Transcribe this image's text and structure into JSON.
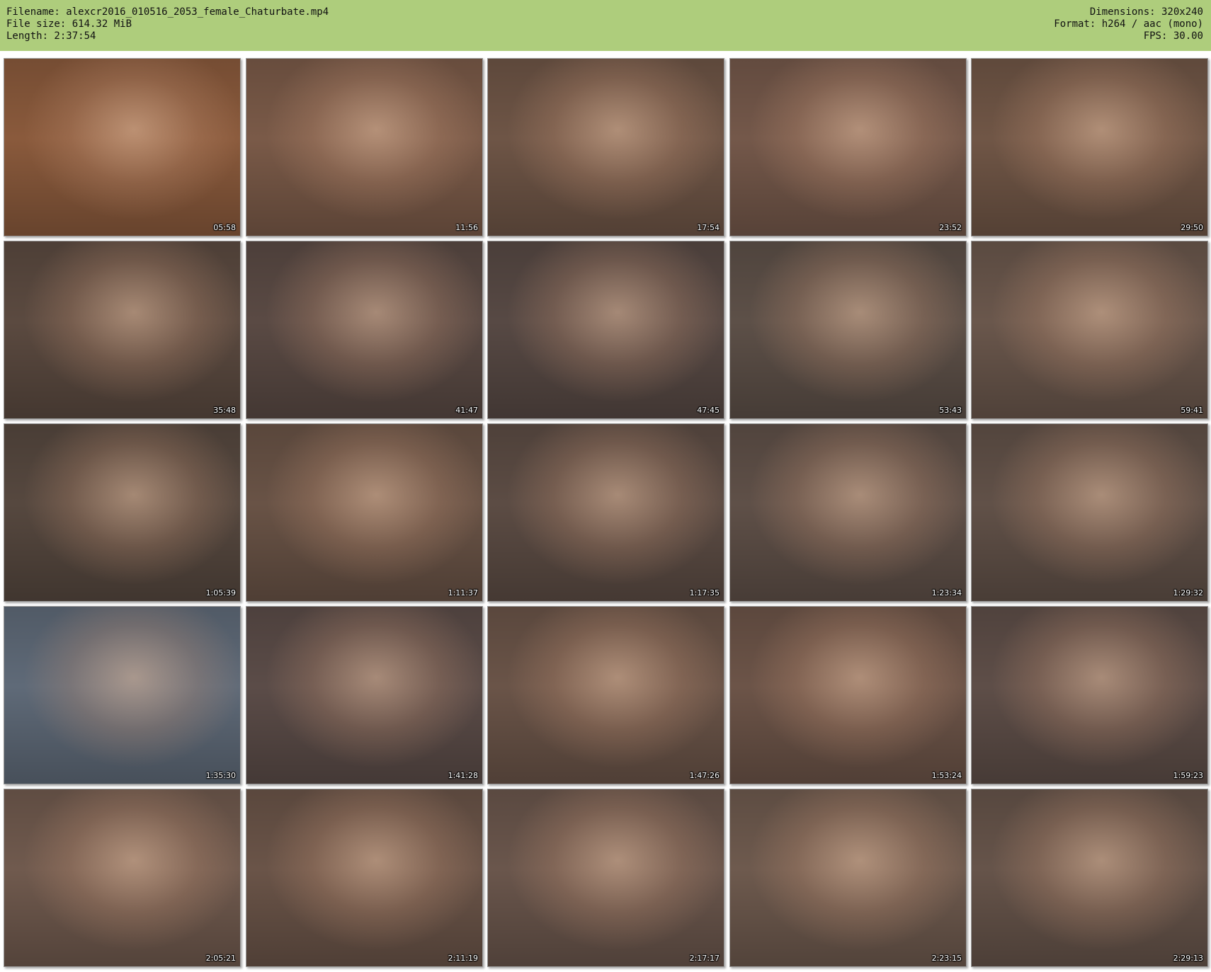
{
  "header": {
    "filename": "Filename: alexcr2016_010516_2053_female_Chaturbate.mp4",
    "filesize": "File size: 614.32 MiB",
    "length": "Length: 2:37:54",
    "dimensions": "Dimensions: 320x240",
    "format": "Format: h264 / aac (mono)",
    "fps": "FPS: 30.00"
  },
  "colors": {
    "header_bg": "#aecd7c",
    "page_bg": "#ffffff"
  },
  "thumbnails": [
    {
      "time": "05:58",
      "tone": "#8a5a3c"
    },
    {
      "time": "11:56",
      "tone": "#7a5a48"
    },
    {
      "time": "17:54",
      "tone": "#6e5546"
    },
    {
      "time": "23:52",
      "tone": "#74584a"
    },
    {
      "time": "29:50",
      "tone": "#705646"
    },
    {
      "time": "35:48",
      "tone": "#5b4a40"
    },
    {
      "time": "41:47",
      "tone": "#5a4a44"
    },
    {
      "time": "47:45",
      "tone": "#574944"
    },
    {
      "time": "53:43",
      "tone": "#5d5048"
    },
    {
      "time": "59:41",
      "tone": "#6a574c"
    },
    {
      "time": "1:05:39",
      "tone": "#56483f"
    },
    {
      "time": "1:11:37",
      "tone": "#695346"
    },
    {
      "time": "1:17:35",
      "tone": "#5c4c44"
    },
    {
      "time": "1:23:34",
      "tone": "#5f5048"
    },
    {
      "time": "1:29:32",
      "tone": "#615148"
    },
    {
      "time": "1:35:30",
      "tone": "#5f6a78"
    },
    {
      "time": "1:41:28",
      "tone": "#5b4c48"
    },
    {
      "time": "1:47:26",
      "tone": "#6a5448"
    },
    {
      "time": "1:53:24",
      "tone": "#6c5448"
    },
    {
      "time": "1:59:23",
      "tone": "#5e4e48"
    },
    {
      "time": "2:05:21",
      "tone": "#705a4e"
    },
    {
      "time": "2:11:19",
      "tone": "#6a5448"
    },
    {
      "time": "2:17:17",
      "tone": "#6a564c"
    },
    {
      "time": "2:23:15",
      "tone": "#6e5a4e"
    },
    {
      "time": "2:29:13",
      "tone": "#66544a"
    }
  ]
}
